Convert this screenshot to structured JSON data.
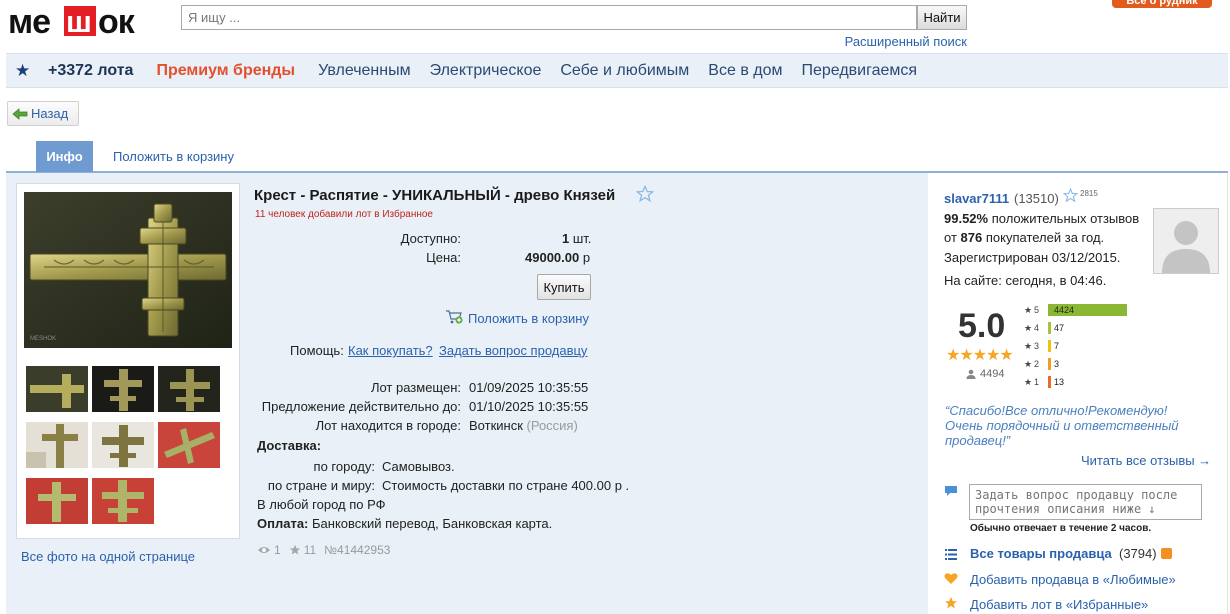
{
  "header": {
    "logo_text": "МЕШОК",
    "search_placeholder": "Я ищу ...",
    "search_button": "Найти",
    "advanced_search": "Расширенный поиск",
    "top_button": "Все о рудник"
  },
  "nav": {
    "lots": "+3372 лота",
    "premium": "Премиум бренды",
    "items": [
      "Увлеченным",
      "Электрическое",
      "Себе и любимым",
      "Все в дом",
      "Передвигаемся"
    ]
  },
  "back": "Назад",
  "tabs": {
    "info": "Инфо",
    "cart": "Положить в корзину"
  },
  "gallery": {
    "all_photos": "Все фото на одной странице"
  },
  "lot": {
    "title": "Крест - Распятие - УНИКАЛЬНЫЙ - древо Князей",
    "favorites_note": "11 человек добавили лот в Избранное",
    "available_label": "Доступно:",
    "available_value": "1",
    "available_unit": "шт.",
    "price_label": "Цена:",
    "price_value": "49000.00",
    "price_unit": "р",
    "buy_button": "Купить",
    "put_in_cart": "Положить в корзину",
    "help_label": "Помощь:",
    "help_how": "Как покупать?",
    "help_ask": "Задать вопрос продавцу",
    "placed_label": "Лот размещен:",
    "placed_value": "01/09/2025 10:35:55",
    "valid_label": "Предложение действительно до:",
    "valid_value": "01/10/2025 10:35:55",
    "city_label": "Лот находится в городе:",
    "city_value": "Воткинск",
    "country": "(Россия)",
    "delivery_label": "Доставка:",
    "by_city_label": "по городу:",
    "by_city_value": "Самовывоз.",
    "by_country_label": "по стране и миру:",
    "by_country_value": "Стоимость доставки по стране 400.00 р .",
    "any_city": "В любой город по РФ",
    "payment_label": "Оплата:",
    "payment_value": "Банковский перевод, Банковская карта.",
    "views": "1",
    "stars": "11",
    "lot_number": "№41442953"
  },
  "seller": {
    "name": "slavar7111",
    "count": "(13510)",
    "sup": "2815",
    "positive_pct": "99.52%",
    "positive_text": "положительных отзывов",
    "from": "от",
    "buyers": "876",
    "buyers_text": "покупателей за год.",
    "registered": "Зарегистрирован 03/12/2015.",
    "online": "На сайте: сегодня, в 04:46.",
    "rating": "5.0",
    "rating_stars": "★★★★★",
    "total_reviews": "4494",
    "distribution": [
      {
        "star": "5",
        "count": "4424",
        "fraction": 0.9844
      },
      {
        "star": "4",
        "count": "47",
        "fraction": 0.0105
      },
      {
        "star": "3",
        "count": "7",
        "fraction": 0.0016
      },
      {
        "star": "2",
        "count": "3",
        "fraction": 0.0007
      },
      {
        "star": "1",
        "count": "13",
        "fraction": 0.0029
      }
    ],
    "quote": "“Спасибо!Все отлично!Рекомендую! Очень порядочный и ответственный продавец!”",
    "read_all": "Читать все отзывы →",
    "ask_placeholder": "Задать вопрос продавцу после прочтения описания ниже ↓",
    "response_time": "Обычно отвечает в течение 2 часов.",
    "all_goods": "Все товары продавца",
    "goods_count": "(3794)",
    "add_fav_seller": "Добавить продавца в «Любимые»",
    "add_fav_lot": "Добавить лот в «Избранные»"
  },
  "colors": {
    "accent": "#2b62ad",
    "premium": "#e4502d",
    "tab": "#6f9bd1",
    "nav_bg": "#e9f0f8",
    "bar5": "#8bb833",
    "bar4": "#a5c63b",
    "bar3": "#f2c012",
    "bar2": "#f49c21",
    "bar1": "#ec6a2a"
  }
}
